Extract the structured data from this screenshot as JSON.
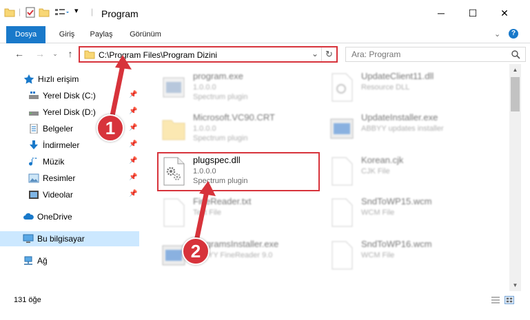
{
  "window": {
    "title": "Program",
    "minimize": "─",
    "maximize": "☐",
    "close": "✕"
  },
  "ribbon": {
    "tabs": [
      "Dosya",
      "Giriş",
      "Paylaş",
      "Görünüm"
    ]
  },
  "address": {
    "path": "C:\\Program Files\\Program Dizini",
    "search_placeholder": "Ara: Program"
  },
  "sidebar": {
    "items": [
      {
        "label": "Hızlı erişim",
        "icon": "star-icon"
      },
      {
        "label": "Yerel Disk (C:)",
        "icon": "drive-icon"
      },
      {
        "label": "Yerel Disk (D:)",
        "icon": "drive-icon"
      },
      {
        "label": "Belgeler",
        "icon": "documents-icon"
      },
      {
        "label": "İndirmeler",
        "icon": "download-icon"
      },
      {
        "label": "Müzik",
        "icon": "music-icon"
      },
      {
        "label": "Resimler",
        "icon": "pictures-icon"
      },
      {
        "label": "Videolar",
        "icon": "video-icon"
      },
      {
        "label": "OneDrive",
        "icon": "cloud-icon"
      },
      {
        "label": "Bu bilgisayar",
        "icon": "computer-icon"
      },
      {
        "label": "Ağ",
        "icon": "network-icon"
      }
    ]
  },
  "files": {
    "left": [
      {
        "name": "program.exe",
        "line1": "1.0.0.0",
        "line2": "Spectrum plugin"
      },
      {
        "name": "Microsoft.VC90.CRT",
        "line1": "1.0.0.0",
        "line2": "Spectrum plugin"
      },
      {
        "name": "plugspec.dll",
        "line1": "1.0.0.0",
        "line2": "Spectrum plugin"
      },
      {
        "name": "FineReader.txt",
        "line1": "Text File",
        "line2": ""
      },
      {
        "name": "programsInstaller.exe",
        "line1": "ABBYY FineReader 9.0",
        "line2": ""
      }
    ],
    "right": [
      {
        "name": "UpdateClient11.dll",
        "line1": "Resource DLL",
        "line2": ""
      },
      {
        "name": "UpdateInstaller.exe",
        "line1": "ABBYY updates installer",
        "line2": ""
      },
      {
        "name": "Korean.cjk",
        "line1": "CJK File",
        "line2": ""
      },
      {
        "name": "SndToWP15.wcm",
        "line1": "WCM File",
        "line2": ""
      },
      {
        "name": "SndToWP16.wcm",
        "line1": "WCM File",
        "line2": ""
      }
    ]
  },
  "callouts": [
    "1",
    "2"
  ],
  "status": {
    "count": "131 öğe"
  },
  "colors": {
    "accent": "#1979ca",
    "highlight": "#d7333b",
    "selected": "#cce8ff"
  }
}
